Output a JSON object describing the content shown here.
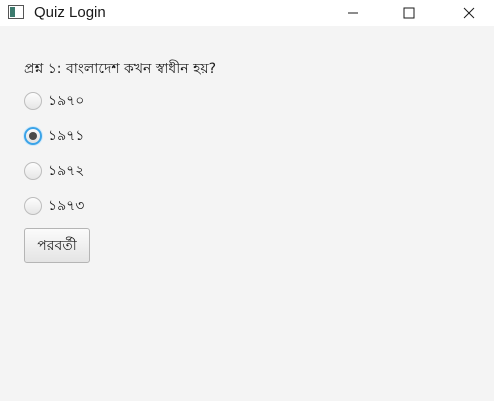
{
  "window": {
    "title": "Quiz Login",
    "app_icon": "java-window-icon",
    "controls": {
      "minimize_icon": "minimize-icon",
      "maximize_icon": "maximize-icon",
      "close_icon": "close-icon"
    }
  },
  "quiz": {
    "question": "প্রশ্ন ১: বাংলাদেশ কখন স্বাধীন হয়?",
    "options": [
      {
        "label": "১৯৭০",
        "selected": false
      },
      {
        "label": "১৯৭১",
        "selected": true
      },
      {
        "label": "১৯৭২",
        "selected": false
      },
      {
        "label": "১৯৭৩",
        "selected": false
      }
    ],
    "next_label": "পরবর্তী"
  },
  "colors": {
    "background": "#f4f4f4",
    "titlebar": "#ffffff",
    "focus_ring": "#3aa3e8"
  }
}
